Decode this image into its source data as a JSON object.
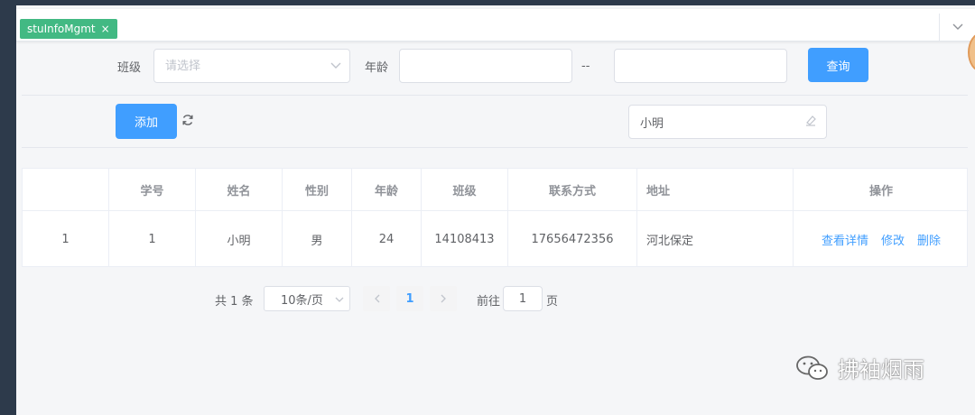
{
  "tabs": {
    "active_label": "stuInfoMgmt",
    "close_glyph": "×"
  },
  "filters": {
    "class_label": "班级",
    "class_placeholder": "请选择",
    "age_label": "年龄",
    "range_separator": "--",
    "age_min_value": "",
    "age_max_value": "",
    "query_button": "查询"
  },
  "toolbar": {
    "add_button": "添加",
    "refresh_icon": "refresh-icon",
    "search_value": "小明",
    "clear_icon": "eraser-icon"
  },
  "table": {
    "headers": [
      "",
      "学号",
      "姓名",
      "性别",
      "年龄",
      "班级",
      "联系方式",
      "地址",
      "操作"
    ],
    "rows": [
      {
        "index": "1",
        "id": "1",
        "name": "小明",
        "gender": "男",
        "age": "24",
        "class": "14108413",
        "phone": "17656472356",
        "address": "河北保定",
        "actions": [
          "查看详情",
          "修改",
          "删除"
        ]
      }
    ]
  },
  "pagination": {
    "total": "共 1 条",
    "page_size": "10条/页",
    "current_page": "1",
    "goto_label": "前往",
    "goto_value": "1",
    "page_unit": "页"
  },
  "watermark": {
    "text": "拂袖烟雨"
  },
  "colors": {
    "primary": "#409eff",
    "tag_green": "#42b983",
    "sidebar": "#2d3a4b"
  }
}
